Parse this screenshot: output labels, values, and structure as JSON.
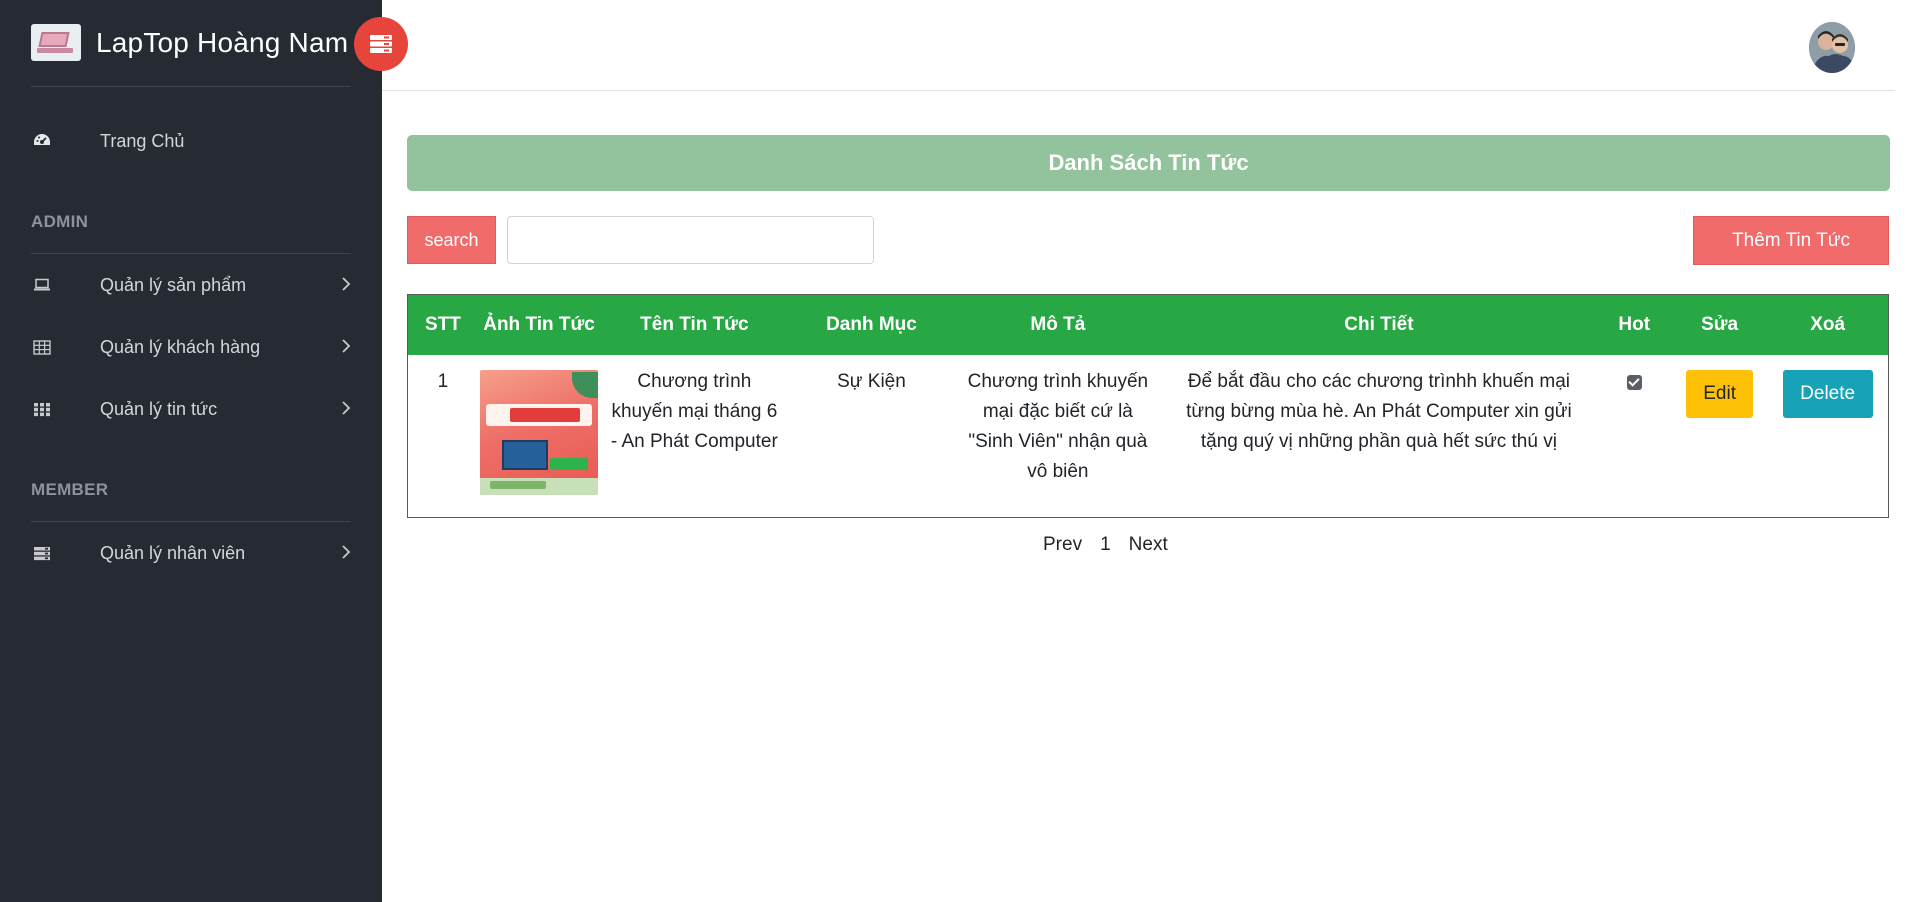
{
  "brand": {
    "name": "LapTop Hoàng Nam"
  },
  "sidebar": {
    "home": {
      "label": "Trang Chủ",
      "icon": "dashboard-icon"
    },
    "admin_title": "ADMIN",
    "admin_items": [
      {
        "label": "Quản lý sản phẩm",
        "icon": "laptop-icon"
      },
      {
        "label": "Quản lý khách hàng",
        "icon": "table-icon"
      },
      {
        "label": "Quản lý tin tức",
        "icon": "grid-icon"
      }
    ],
    "member_title": "MEMBER",
    "member_items": [
      {
        "label": "Quản lý nhân viên",
        "icon": "list-icon"
      }
    ]
  },
  "colors": {
    "sidebar_bg": "#262a32",
    "accent_red": "#e7443c",
    "title_bar": "#93c39c",
    "table_header": "#28a745",
    "search_btn": "#f26b6b",
    "edit_btn": "#ffc107",
    "delete_btn": "#17a2b8"
  },
  "main": {
    "title": "Danh Sách Tin Tức",
    "search": {
      "button_label": "search",
      "value": "",
      "placeholder": ""
    },
    "add_button_label": "Thêm Tin Tức",
    "table": {
      "columns": [
        "STT",
        "Ảnh Tin Tức",
        "Tên Tin Tức",
        "Danh Mục",
        "Mô Tả",
        "Chi Tiết",
        "Hot",
        "Sửa",
        "Xoá"
      ],
      "rows": [
        {
          "stt": "1",
          "name": "Chương trình khuyến mại tháng 6 - An Phát Computer",
          "category": "Sự Kiện",
          "description": "Chương trình khuyến mại đặc biết cứ là \"Sinh Viên\" nhận quà vô biên",
          "detail": "Để bắt đầu cho các chương trìnhh khuến mại từng bừng mùa hè. An Phát Computer xin gửi tặng quý vị những phần quà hết sức thú vị",
          "hot": true,
          "edit_label": "Edit",
          "delete_label": "Delete"
        }
      ]
    },
    "pagination": {
      "prev": "Prev",
      "page": "1",
      "next": "Next"
    }
  }
}
